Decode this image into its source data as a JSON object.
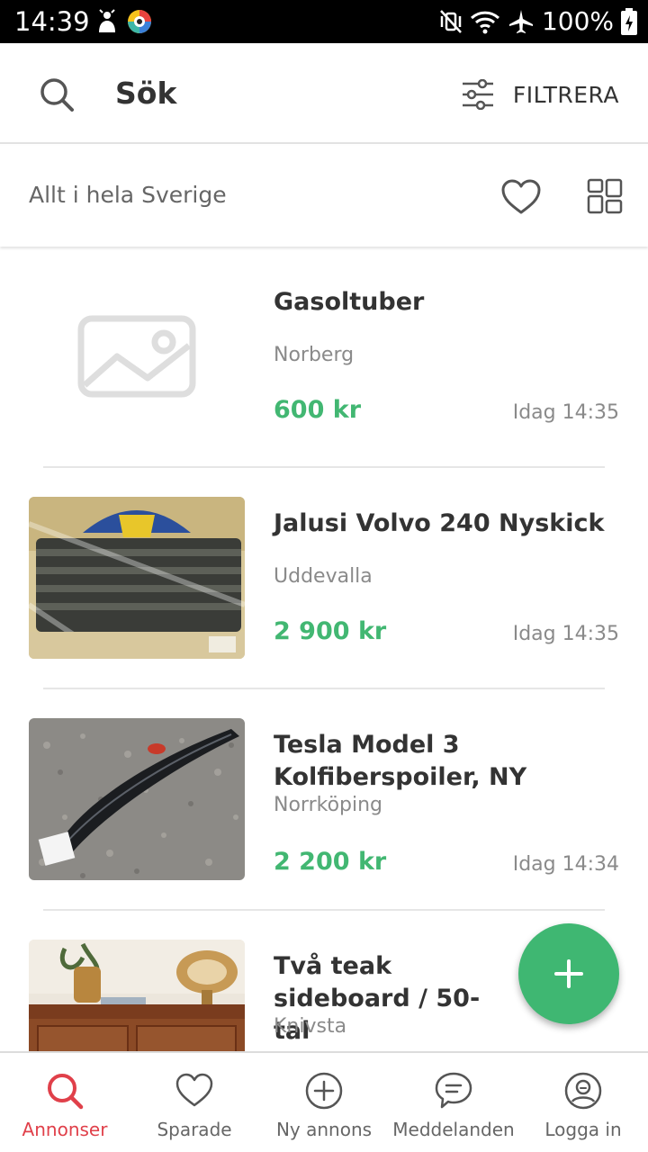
{
  "status_bar": {
    "time": "14:39",
    "battery_percent": "100%",
    "icons": [
      "notification-icon",
      "app-icon",
      "vibrate-icon",
      "wifi-icon",
      "airplane-icon",
      "battery-icon"
    ]
  },
  "search_bar": {
    "title": "Sök",
    "filter_label": "FILTRERA"
  },
  "location_bar": {
    "location": "Allt i hela Sverige"
  },
  "listings": [
    {
      "title": "Gasoltuber",
      "location": "Norberg",
      "price": "600 kr",
      "time": "Idag 14:35",
      "image": "placeholder-image-icon"
    },
    {
      "title": "Jalusi Volvo 240 Nyskick",
      "location": "Uddevalla",
      "price": "2 900 kr",
      "time": "Idag 14:35",
      "image": "volvo-grille-photo"
    },
    {
      "title": "Tesla Model 3 Kolfiberspoiler, NY",
      "location": "Norrköping",
      "price": "2 200 kr",
      "time": "Idag 14:34",
      "image": "spoiler-photo"
    },
    {
      "title": "Två teak sideboard / 50-tal",
      "location": "Knivsta",
      "price": "",
      "time": "",
      "image": "sideboard-photo"
    }
  ],
  "fab": {
    "icon": "plus-icon"
  },
  "bottom_nav": {
    "items": [
      {
        "label": "Annonser",
        "icon": "search-icon",
        "active": true
      },
      {
        "label": "Sparade",
        "icon": "heart-icon",
        "active": false
      },
      {
        "label": "Ny annons",
        "icon": "plus-circle-icon",
        "active": false
      },
      {
        "label": "Meddelanden",
        "icon": "chat-icon",
        "active": false
      },
      {
        "label": "Logga in",
        "icon": "user-icon",
        "active": false
      }
    ]
  },
  "colors": {
    "price_green": "#42b772",
    "fab_green": "#3fb772",
    "active_red": "#e0404a"
  }
}
